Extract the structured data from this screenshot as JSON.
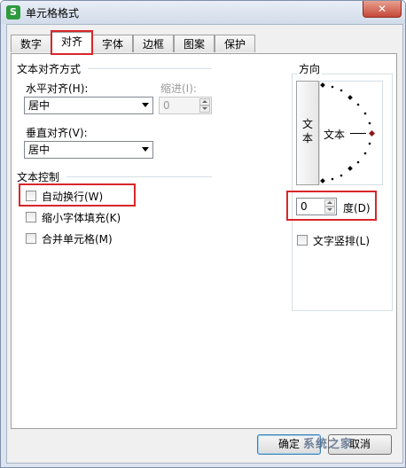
{
  "window": {
    "title": "单元格格式",
    "close_label": "✕"
  },
  "tabs": [
    {
      "label": "数字"
    },
    {
      "label": "对齐"
    },
    {
      "label": "字体"
    },
    {
      "label": "边框"
    },
    {
      "label": "图案"
    },
    {
      "label": "保护"
    }
  ],
  "alignment": {
    "group_title": "文本对齐方式",
    "horizontal_label": "水平对齐(H):",
    "horizontal_value": "居中",
    "indent_label": "缩进(I):",
    "indent_value": "0",
    "vertical_label": "垂直对齐(V):",
    "vertical_value": "居中"
  },
  "text_control": {
    "group_title": "文本控制",
    "wrap_text": "自动换行(W)",
    "shrink_to_fit": "缩小字体填充(K)",
    "merge_cells": "合并单元格(M)"
  },
  "orientation": {
    "group_title": "方向",
    "vertical_text": [
      "文",
      "本"
    ],
    "dial_text": "文本",
    "degree_value": "0",
    "degree_label": "度(D)",
    "vertical_stack_label": "文字竖排(L)"
  },
  "buttons": {
    "ok": "确定",
    "cancel": "取消"
  },
  "watermark": "系统之家",
  "colors": {
    "highlight": "#d8262a",
    "app_icon": "#2e9a3e"
  }
}
